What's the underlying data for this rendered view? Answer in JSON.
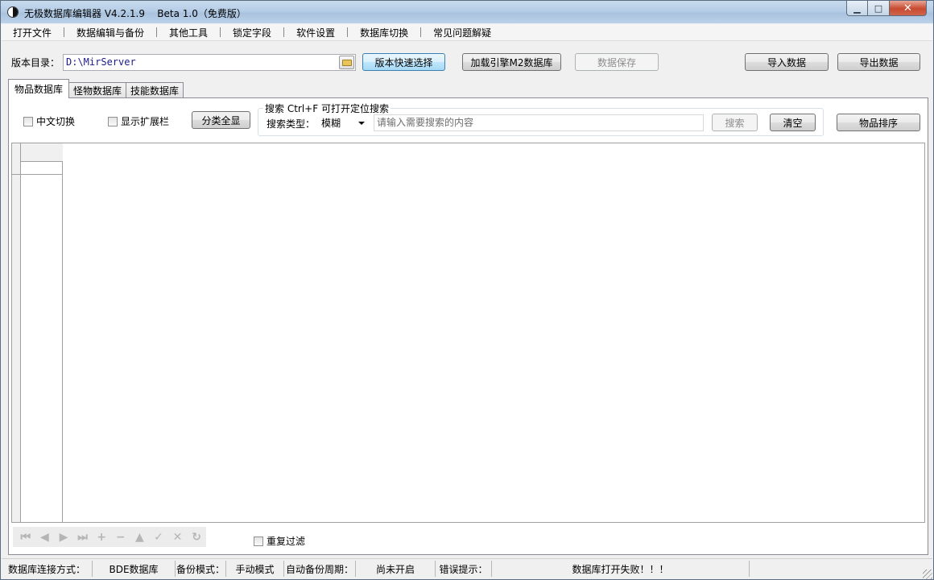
{
  "window": {
    "title": "无极数据库编辑器 V4.2.1.9    Beta 1.0（免费版）",
    "min": "▁",
    "max": "□",
    "close": "✕"
  },
  "menu": [
    "打开文件",
    "数据编辑与备份",
    "其他工具",
    "锁定字段",
    "软件设置",
    "数据库切换",
    "常见问题解疑"
  ],
  "toolbar": {
    "version_dir_label": "版本目录：",
    "version_dir_value": "D:\\MirServer",
    "quick_select": "版本快速选择",
    "load_m2": "加载引擎M2数据库",
    "save": "数据保存",
    "import": "导入数据",
    "export": "导出数据"
  },
  "tabs": [
    "物品数据库",
    "怪物数据库",
    "技能数据库"
  ],
  "items_tab": {
    "chinese_switch": "中文切换",
    "show_ext": "显示扩展栏",
    "show_all_categories": "分类全显",
    "search_group_title": "搜索  Ctrl+F 可打开定位搜索",
    "search_type_label": "搜索类型：",
    "search_type_value": "模糊",
    "search_placeholder": "请输入需要搜索的内容",
    "search_button": "搜索",
    "clear_button": "清空",
    "sort_button": "物品排序",
    "dedupe_filter": "重复过滤"
  },
  "navigator": [
    {
      "name": "first-record-icon",
      "glyph": "⏮"
    },
    {
      "name": "prior-record-icon",
      "glyph": "◀"
    },
    {
      "name": "next-record-icon",
      "glyph": "▶"
    },
    {
      "name": "last-record-icon",
      "glyph": "⏭"
    },
    {
      "name": "insert-record-icon",
      "glyph": "+"
    },
    {
      "name": "delete-record-icon",
      "glyph": "−"
    },
    {
      "name": "edit-record-icon",
      "glyph": "▲"
    },
    {
      "name": "post-record-icon",
      "glyph": "✓"
    },
    {
      "name": "cancel-record-icon",
      "glyph": "✕"
    },
    {
      "name": "refresh-record-icon",
      "glyph": "↻"
    }
  ],
  "status": {
    "conn_label": "数据库连接方式：",
    "conn_value": "BDE数据库",
    "backup_mode_label": "备份模式：",
    "backup_mode_value": "手动模式",
    "auto_backup_label": "自动备份周期：",
    "auto_backup_value": "尚未开启",
    "error_label": "错误提示：",
    "error_value": "数据库打开失败！！！"
  }
}
